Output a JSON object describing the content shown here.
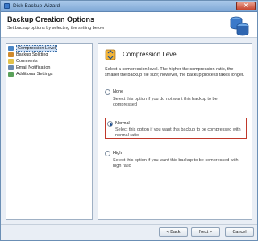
{
  "window": {
    "title": "Disk Backup Wizard",
    "close_glyph": "✕"
  },
  "header": {
    "title": "Backup Creation Options",
    "subtitle": "Set backup options by selecting the setting below"
  },
  "nav": {
    "items": [
      {
        "label": "Compression Level",
        "icon": "compression-icon",
        "color": "#4a86c5",
        "selected": true
      },
      {
        "label": "Backup Splitting",
        "icon": "splitting-icon",
        "color": "#d08a2d",
        "selected": false
      },
      {
        "label": "Comments",
        "icon": "comments-icon",
        "color": "#e2c24a",
        "selected": false
      },
      {
        "label": "Email Notification",
        "icon": "email-icon",
        "color": "#6b8ab0",
        "selected": false
      },
      {
        "label": "Additional Settings",
        "icon": "settings-icon",
        "color": "#5aa15a",
        "selected": false
      }
    ]
  },
  "panel": {
    "title": "Compression Level",
    "description": "Select a compression level. The higher the compression ratio, the smaller the backup file size; however, the backup process takes longer.",
    "options": [
      {
        "label": "None",
        "desc": "Select this option if you do not want this backup to be compressed",
        "checked": false
      },
      {
        "label": "Normal",
        "desc": "Select this option if you want this backup to be compressed with normal ratio",
        "checked": true
      },
      {
        "label": "High",
        "desc": "Select this option if you want this backup to be compressed with high ratio",
        "checked": false
      }
    ]
  },
  "footer": {
    "back_label": "< Back",
    "next_label": "Next >",
    "cancel_label": "Cancel"
  },
  "colors": {
    "accent": "#3a6ea5",
    "selection_border": "#c0392b",
    "title_bar": "#7fa8d6"
  }
}
